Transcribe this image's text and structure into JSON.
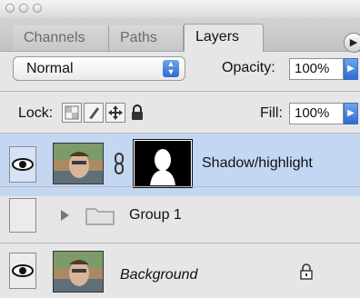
{
  "tabs": [
    {
      "label": "Channels",
      "active": false
    },
    {
      "label": "Paths",
      "active": false
    },
    {
      "label": "Layers",
      "active": true
    }
  ],
  "blend_mode": "Normal",
  "opacity": {
    "label": "Opacity:",
    "value": "100%"
  },
  "lock": {
    "label": "Lock:"
  },
  "fill": {
    "label": "Fill:",
    "value": "100%"
  },
  "layers": [
    {
      "name": "Shadow/highlight",
      "visible": true,
      "selected": true,
      "has_mask": true
    },
    {
      "name": "Group 1",
      "visible": false,
      "type": "group",
      "collapsed": true
    },
    {
      "name": "Background",
      "visible": true,
      "locked": true
    }
  ],
  "colors": {
    "selection": "#c3d7f3",
    "accent_blue": "#2e6cd0"
  }
}
